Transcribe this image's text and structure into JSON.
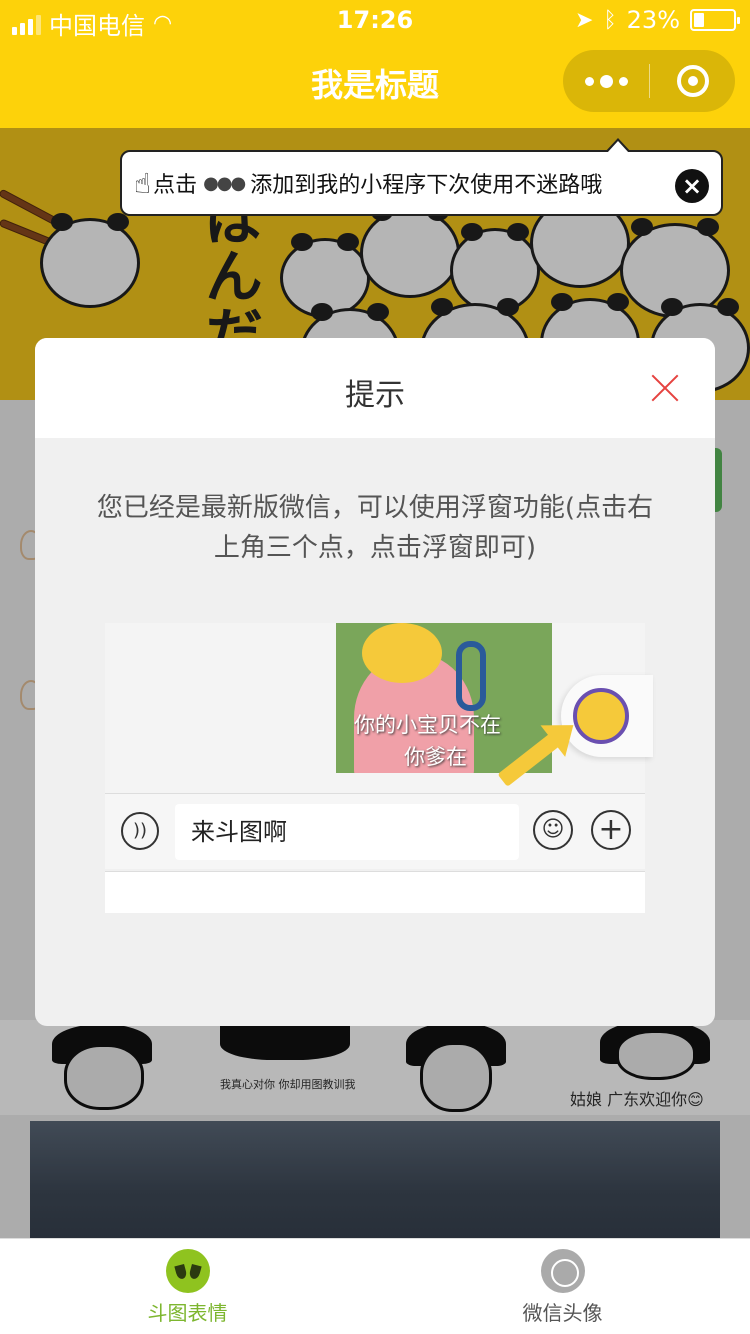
{
  "status_bar": {
    "carrier": "中国电信",
    "time": "17:26",
    "battery": "23%"
  },
  "nav": {
    "title": "我是标题"
  },
  "tip_bar": {
    "text_before": "点击",
    "dots": "●●●",
    "text_after": "添加到我的小程序下次使用不迷路哦"
  },
  "modal": {
    "title": "提示",
    "message": "您已经是最新版微信，可以使用浮窗功能(点击右上角三个点，点击浮窗即可)",
    "demo": {
      "image_caption_line1": "你的小宝贝不在",
      "image_caption_line2": "你爹在",
      "input_text": "来斗图啊"
    }
  },
  "background": {
    "meme_caption_1": "我真心对你 你却用图教训我",
    "meme_caption_2": "姑娘 广东欢迎你😊"
  },
  "tabbar": {
    "items": [
      {
        "label": "斗图表情",
        "active": true
      },
      {
        "label": "微信头像",
        "active": false
      }
    ],
    "active_color": "#7db62f"
  },
  "colors": {
    "nav_yellow": "#fdd20a",
    "close_red": "#e64340"
  }
}
